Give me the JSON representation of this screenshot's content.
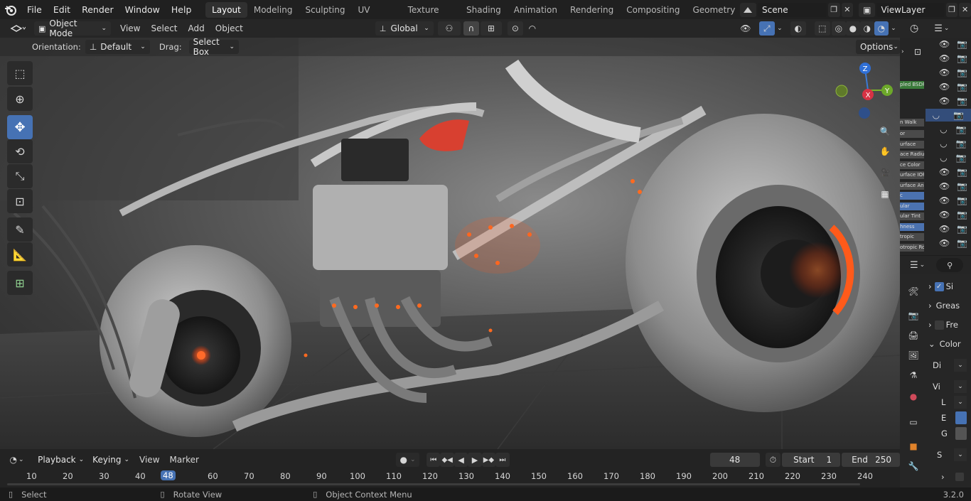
{
  "menus": [
    "File",
    "Edit",
    "Render",
    "Window",
    "Help"
  ],
  "workspace_tabs": [
    "Layout",
    "Modeling",
    "Sculpting",
    "UV Editing",
    "Texture Paint",
    "Shading",
    "Animation",
    "Rendering",
    "Compositing",
    "Geometry Noc"
  ],
  "active_tab": "Layout",
  "scene_name": "Scene",
  "view_layer": "ViewLayer",
  "viewport_header": {
    "mode": "Object Mode",
    "menus": [
      "View",
      "Select",
      "Add",
      "Object"
    ],
    "transform_orientation": "Global"
  },
  "tool_settings": {
    "orientation_label": "Orientation:",
    "orientation_value": "Default",
    "drag_label": "Drag:",
    "drag_value": "Select Box",
    "options_label": "Options"
  },
  "gizmo": {
    "x": "X",
    "y": "Y",
    "z": "Z"
  },
  "node_labels": [
    "pled BSDF",
    "n Walk",
    "or",
    "urface",
    "ace Radiu",
    "ce Color",
    "urface IOR",
    "urface Ani",
    "c",
    "ular",
    "ular Tint",
    "hness",
    "tropic",
    "otropic Rot"
  ],
  "timeline": {
    "menus": [
      "Playback",
      "Keying",
      "View",
      "Marker"
    ],
    "current_frame": "48",
    "start_label": "Start",
    "start_value": "1",
    "end_label": "End",
    "end_value": "250",
    "ruler": [
      "10",
      "20",
      "30",
      "40",
      "48",
      "60",
      "70",
      "80",
      "90",
      "100",
      "110",
      "120",
      "130",
      "140",
      "150",
      "160",
      "170",
      "180",
      "190",
      "200",
      "210",
      "220",
      "230",
      "240"
    ]
  },
  "status": {
    "select": "Select",
    "rotate": "Rotate View",
    "context": "Object Context Menu",
    "version": "3.2.0"
  },
  "properties": {
    "rows": [
      "Si",
      "Greas",
      "Fre",
      "Color",
      "Di",
      "Vi",
      "L",
      "E",
      "G",
      "S"
    ]
  },
  "colors": {
    "accent": "#4672b4",
    "active_tab": "#303030",
    "glow": "#ff5a1a"
  }
}
